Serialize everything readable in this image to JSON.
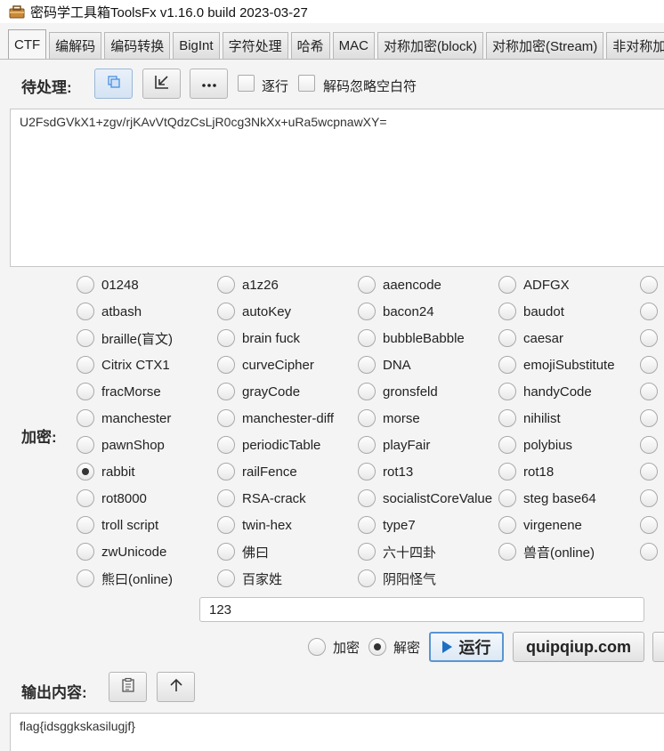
{
  "window": {
    "title": "密码学工具箱ToolsFx v1.16.0 build 2023-03-27"
  },
  "tabs": [
    {
      "label": "CTF"
    },
    {
      "label": "编解码"
    },
    {
      "label": "编码转换"
    },
    {
      "label": "BigInt"
    },
    {
      "label": "字符处理"
    },
    {
      "label": "哈希"
    },
    {
      "label": "MAC"
    },
    {
      "label": "对称加密(block)"
    },
    {
      "label": "对称加密(Stream)"
    },
    {
      "label": "非对称加"
    }
  ],
  "input_section": {
    "label": "待处理:",
    "line_mode_label": "逐行",
    "ignore_whitespace_label": "解码忽略空白符",
    "text": "U2FsdGVkX1+zgv/rjKAvVtQdzCsLjR0cg3NkXx+uRa5wcpnawXY="
  },
  "encrypt_section": {
    "label": "加密:",
    "selected": "rabbit",
    "options": [
      [
        "01248",
        "a1z26",
        "aaencode",
        "ADFGX"
      ],
      [
        "atbash",
        "autoKey",
        "bacon24",
        "baudot"
      ],
      [
        "braille(盲文)",
        "brain fuck",
        "bubbleBabble",
        "caesar"
      ],
      [
        "Citrix CTX1",
        "curveCipher",
        "DNA",
        "emojiSubstitute"
      ],
      [
        "fracMorse",
        "grayCode",
        "gronsfeld",
        "handyCode"
      ],
      [
        "manchester",
        "manchester-diff",
        "morse",
        "nihilist"
      ],
      [
        "pawnShop",
        "periodicTable",
        "playFair",
        "polybius"
      ],
      [
        "rabbit",
        "railFence",
        "rot13",
        "rot18"
      ],
      [
        "rot8000",
        "RSA-crack",
        "socialistCoreValue",
        "steg base64"
      ],
      [
        "troll script",
        "twin-hex",
        "type7",
        "virgenene"
      ],
      [
        "zwUnicode",
        "佛曰",
        "六十四卦",
        "兽音(online)"
      ],
      [
        "熊曰(online)",
        "百家姓",
        "阴阳怪气"
      ]
    ],
    "key": "123"
  },
  "actions": {
    "encrypt_label": "加密",
    "decrypt_label": "解密",
    "mode": "decrypt",
    "run_label": "运行",
    "site_label": "quipqiup.com"
  },
  "output_section": {
    "label": "输出内容:",
    "text": "flag{idsggkskasilugjf}"
  }
}
